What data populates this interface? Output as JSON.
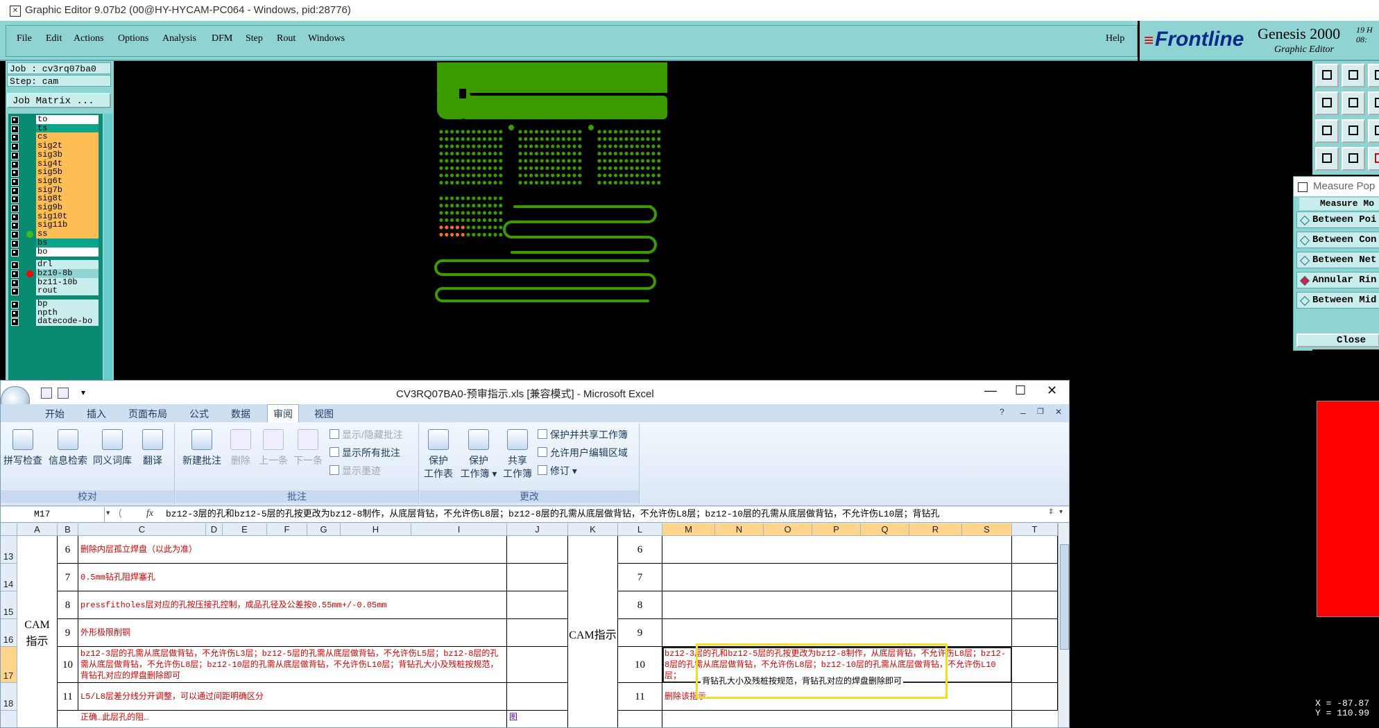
{
  "genesis": {
    "title": "Graphic Editor 9.07b2 (00@HY-HYCAM-PC064 - Windows, pid:28776)",
    "menu": [
      "File",
      "Edit",
      "Actions",
      "Options",
      "Analysis",
      "DFM",
      "Step",
      "Rout",
      "Windows"
    ],
    "help": "Help",
    "brand": {
      "logo": "Frontline",
      "product": "Genesis 2000",
      "subtitle": "Graphic Editor",
      "date_line1": "19",
      "date_line2": "08:"
    },
    "job": "Job : cv3rq07ba0",
    "step": "Step: cam",
    "job_matrix": "Job Matrix ...",
    "layers": [
      {
        "name": "to",
        "color": "#ffffff",
        "dot": ""
      },
      {
        "name": "ts",
        "color": "#0aa58a",
        "dot": ""
      },
      {
        "name": "cs",
        "color": "#ffbe55",
        "dot": ""
      },
      {
        "name": "sig2t",
        "color": "#ffbe55",
        "dot": ""
      },
      {
        "name": "sig3b",
        "color": "#ffbe55",
        "dot": ""
      },
      {
        "name": "sig4t",
        "color": "#ffbe55",
        "dot": ""
      },
      {
        "name": "sig5b",
        "color": "#ffbe55",
        "dot": ""
      },
      {
        "name": "sig6t",
        "color": "#ffbe55",
        "dot": ""
      },
      {
        "name": "sig7b",
        "color": "#ffbe55",
        "dot": ""
      },
      {
        "name": "sig8t",
        "color": "#ffbe55",
        "dot": ""
      },
      {
        "name": "sig9b",
        "color": "#ffbe55",
        "dot": ""
      },
      {
        "name": "sig10t",
        "color": "#ffbe55",
        "dot": ""
      },
      {
        "name": "sig11b",
        "color": "#ffbe55",
        "dot": ""
      },
      {
        "name": "ss",
        "color": "#ffbe55",
        "dot": "#3cba1e"
      },
      {
        "name": "bs",
        "color": "#0aa58a",
        "dot": ""
      },
      {
        "name": "bo",
        "color": "#ffffff",
        "dot": ""
      },
      {
        "name": "drl",
        "color": "#c9eded",
        "dot": ""
      },
      {
        "name": "bz10-8b",
        "color": "#8fd3d3",
        "dot": "#ff0000"
      },
      {
        "name": "bz11-10b",
        "color": "#c9eded",
        "dot": ""
      },
      {
        "name": "rout",
        "color": "#c9eded",
        "dot": ""
      },
      {
        "name": "bp",
        "color": "#c9eded",
        "dot": ""
      },
      {
        "name": "npth",
        "color": "#c9eded",
        "dot": ""
      },
      {
        "name": "datecode-bo",
        "color": "#c9eded",
        "dot": ""
      }
    ],
    "measure": {
      "title": "Measure Pop",
      "mode_label": "Measure Mo",
      "options": [
        "Between Poi",
        "Between Con",
        "Between Net",
        "Annular Rin",
        "Between Mid"
      ],
      "selected_option": "Annular Rin",
      "close": "Close"
    },
    "coords": {
      "x": "X = -87.87",
      "y": "Y = 110.99"
    },
    "colors": {
      "pcb_green": "#3a9a00",
      "panel_cyan": "#8fd3d3"
    }
  },
  "excel": {
    "title": "CV3RQ07BA0-预审指示.xls  [兼容模式] - Microsoft Excel",
    "tabs": [
      "开始",
      "插入",
      "页面布局",
      "公式",
      "数据",
      "审阅",
      "视图"
    ],
    "active_tab": "审阅",
    "ribbon": {
      "proofing": {
        "label": "校对",
        "buttons": [
          "拼写检查",
          "信息检索",
          "同义词库",
          "翻译"
        ]
      },
      "comments": {
        "label": "批注",
        "buttons": [
          "新建批注",
          "删除",
          "上一条",
          "下一条"
        ],
        "small": [
          "显示/隐藏批注",
          "显示所有批注",
          "显示墨迹"
        ]
      },
      "changes": {
        "label": "更改",
        "buttons": [
          {
            "line1": "保护",
            "line2": "工作表"
          },
          {
            "line1": "保护",
            "line2": "工作簿 ▾"
          },
          {
            "line1": "共享",
            "line2": "工作簿"
          }
        ],
        "small": [
          "保护并共享工作簿",
          "允许用户编辑区域",
          "修订 ▾"
        ]
      }
    },
    "name_box": "M17",
    "formula": "bz12-3层的孔和bz12-5层的孔按更改为bz12-8制作，从底层背钻，不允许伤L8层；bz12-8层的孔需从底层做背钻，不允许伤L8层；bz12-10层的孔需从底层做背钻，不允许伤L10层；背钻孔",
    "columns": [
      "A",
      "B",
      "C",
      "D",
      "E",
      "F",
      "G",
      "H",
      "I",
      "J",
      "K",
      "L",
      "M",
      "N",
      "O",
      "P",
      "Q",
      "R",
      "S",
      "T"
    ],
    "row_numbers": [
      "13",
      "14",
      "15",
      "16",
      "17",
      "18"
    ],
    "merged_a": "CAM指示",
    "merged_k": "CAM指示",
    "rows": [
      {
        "n": "6",
        "left": "删除内层孤立焊盘（以此为准）",
        "right_n": "6",
        "right": ""
      },
      {
        "n": "7",
        "left": "0.5mm钻孔阻焊塞孔",
        "right_n": "7",
        "right": ""
      },
      {
        "n": "8",
        "left": "pressfitholes层对应的孔按压接孔控制，成品孔径及公差按0.55mm+/-0.05mm",
        "right_n": "8",
        "right": ""
      },
      {
        "n": "9",
        "left": "外形极限削铜",
        "right_n": "9",
        "right": ""
      },
      {
        "n": "10",
        "left": "bz12-3层的孔需从底层做背钻，不允许伤L3层；bz12-5层的孔需从底层做背钻，不允许伤L5层；bz12-8层的孔需从底层做背钻，不允许伤L8层；bz12-10层的孔需从底层做背钻，不允许伤L10层；背钻孔大小及残桩按规范，背钻孔对应的焊盘删除即可",
        "right_n": "10",
        "right": "bz12-3层的孔和bz12-5层的孔按更改为bz12-8制作，从底层背钻，不允许伤L8层；bz12-8层的孔需从底层做背钻，不允许伤L8层；bz12-10层的孔需从底层做背钻，不允许伤L10层；"
      },
      {
        "n": "11",
        "left": "L5/L8层差分线分开调整，可以通过间距明确区分",
        "right_n": "11",
        "right": "删除该指示"
      }
    ],
    "row19_partial": "图",
    "row19_left_partial": "正确…此层孔的阻…",
    "tooltip_text": "背钻孔大小及残桩按规范，背钻孔对应的焊盘删除即可"
  }
}
